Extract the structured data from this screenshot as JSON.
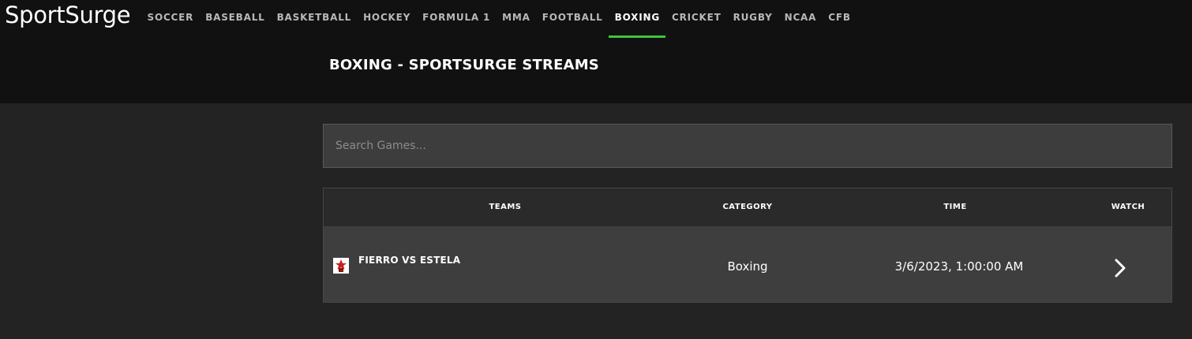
{
  "site": {
    "logo": "SportSurge"
  },
  "nav": {
    "items": [
      {
        "label": "SOCCER"
      },
      {
        "label": "BASEBALL"
      },
      {
        "label": "BASKETBALL"
      },
      {
        "label": "HOCKEY"
      },
      {
        "label": "FORMULA 1"
      },
      {
        "label": "MMA"
      },
      {
        "label": "FOOTBALL"
      },
      {
        "label": "BOXING",
        "active": true
      },
      {
        "label": "CRICKET"
      },
      {
        "label": "RUGBY"
      },
      {
        "label": "NCAA"
      },
      {
        "label": "CFB"
      }
    ],
    "active_color": "#3ec441"
  },
  "page": {
    "title": "BOXING - SPORTSURGE STREAMS"
  },
  "search": {
    "placeholder": "Search Games...",
    "value": ""
  },
  "table": {
    "headers": {
      "teams": "TEAMS",
      "category": "CATEGORY",
      "time": "TIME",
      "watch": "WATCH"
    },
    "rows": [
      {
        "icon": "boxing-team-logo-icon",
        "teams": "FIERRO VS ESTELA",
        "category": "Boxing",
        "time": "3/6/2023, 1:00:00 AM",
        "watch_icon": "chevron-right-icon"
      }
    ]
  },
  "colors": {
    "header_bg": "#111111",
    "page_bg": "#232323",
    "row_bg": "#3e3e3e"
  }
}
